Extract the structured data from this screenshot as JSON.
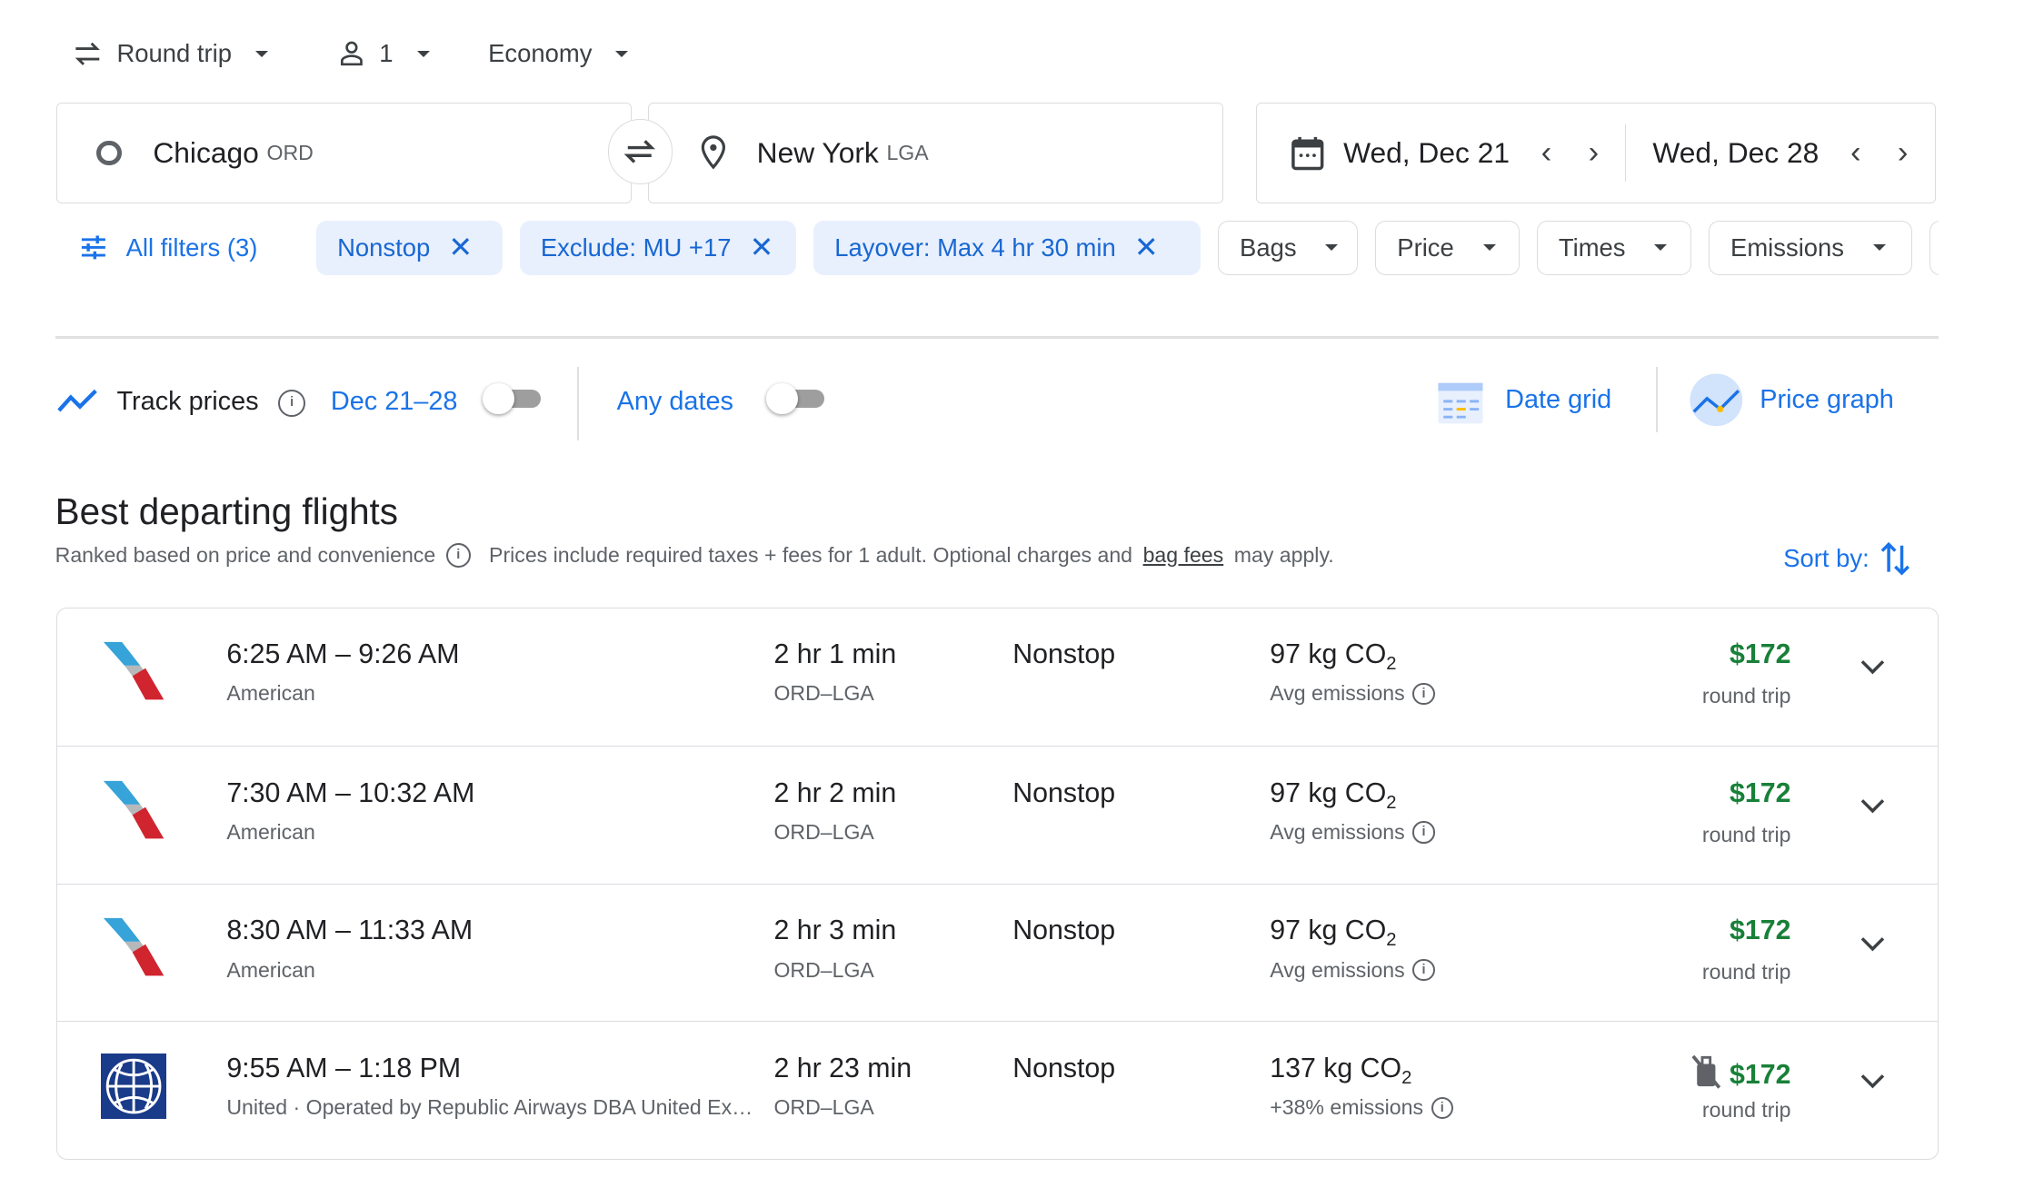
{
  "trip_type": "Round trip",
  "passengers": "1",
  "cabin": "Economy",
  "origin": {
    "city": "Chicago",
    "code": "ORD"
  },
  "destination": {
    "city": "New York",
    "code": "LGA"
  },
  "depart_date": "Wed, Dec 21",
  "return_date": "Wed, Dec 28",
  "filters": {
    "all": "All filters (3)",
    "chips": [
      "Nonstop",
      "Exclude: MU +17",
      "Layover: Max 4 hr 30 min"
    ],
    "dropdowns": [
      "Bags",
      "Price",
      "Times",
      "Emissions"
    ]
  },
  "track": {
    "label": "Track prices",
    "range": "Dec 21–28",
    "any_dates": "Any dates",
    "date_grid": "Date grid",
    "price_graph": "Price graph"
  },
  "section": {
    "title": "Best departing flights",
    "ranked": "Ranked based on price and convenience",
    "prices_note": "Prices include required taxes + fees for 1 adult. Optional charges and",
    "bag_fees": "bag fees",
    "may_apply": "may apply.",
    "sort_by": "Sort by:"
  },
  "flights": [
    {
      "times": "6:25 AM – 9:26 AM",
      "airline": "American",
      "duration": "2 hr 1 min",
      "route": "ORD–LGA",
      "stops": "Nonstop",
      "emissions": "97 kg CO",
      "emissions_note": "Avg emissions",
      "price": "$172",
      "price_type": "round trip"
    },
    {
      "times": "7:30 AM – 10:32 AM",
      "airline": "American",
      "duration": "2 hr 2 min",
      "route": "ORD–LGA",
      "stops": "Nonstop",
      "emissions": "97 kg CO",
      "emissions_note": "Avg emissions",
      "price": "$172",
      "price_type": "round trip"
    },
    {
      "times": "8:30 AM – 11:33 AM",
      "airline": "American",
      "duration": "2 hr 3 min",
      "route": "ORD–LGA",
      "stops": "Nonstop",
      "emissions": "97 kg CO",
      "emissions_note": "Avg emissions",
      "price": "$172",
      "price_type": "round trip"
    },
    {
      "times": "9:55 AM – 1:18 PM",
      "airline": "United · Operated by Republic Airways DBA United Express",
      "duration": "2 hr 23 min",
      "route": "ORD–LGA",
      "stops": "Nonstop",
      "emissions": "137 kg CO",
      "emissions_note": "+38% emissions",
      "price": "$172",
      "price_type": "round trip"
    }
  ],
  "co2_sub": "2"
}
